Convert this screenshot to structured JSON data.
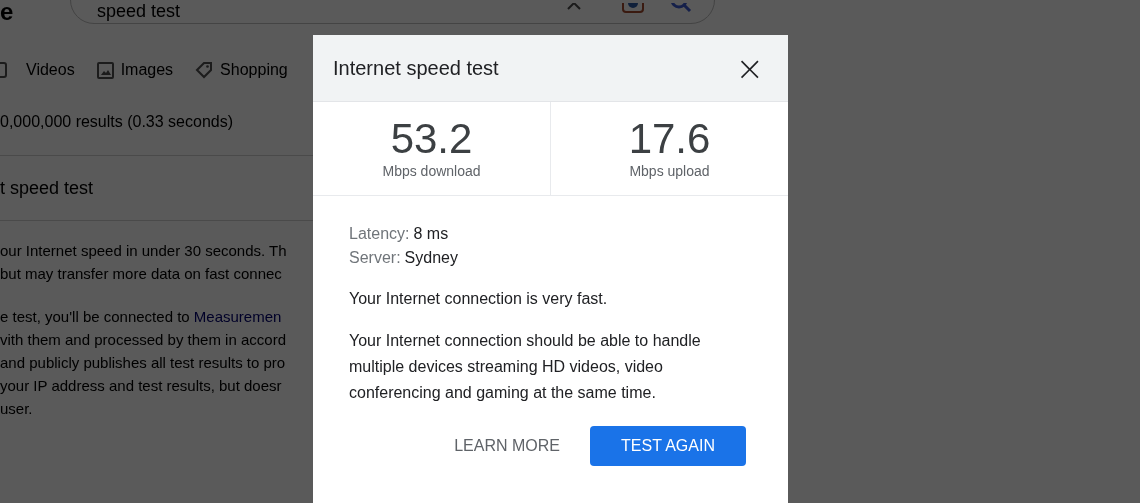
{
  "background_page": {
    "logo_fragment": "e",
    "search": {
      "value": "speed test"
    },
    "tabs": [
      {
        "label": "Videos"
      },
      {
        "label": "Images"
      },
      {
        "label": "Shopping"
      }
    ],
    "result_stats": "0,000,000 results (0.33 seconds)",
    "card_title": "t speed test",
    "paragraphs": [
      [
        {
          "text": "our Internet speed in under 30 seconds. Th"
        },
        {
          "text": " but may transfer more data on fast connec"
        }
      ],
      [
        {
          "text": "e test, you'll be connected to ",
          "link": "Measuremen"
        },
        {
          "text": "vith them and processed by them in accord"
        },
        {
          "text": "and publicly publishes all test results to pro"
        },
        {
          "text": " your IP address and test results, but doesr"
        },
        {
          "text": "user."
        }
      ]
    ]
  },
  "dialog": {
    "title": "Internet speed test",
    "close": "×",
    "stats": [
      {
        "value": "53.2",
        "unit": "Mbps download"
      },
      {
        "value": "17.6",
        "unit": "Mbps upload"
      }
    ],
    "details": [
      {
        "label": "Latency:",
        "value": "8 ms"
      },
      {
        "label": "Server:",
        "value": "Sydney"
      }
    ],
    "verdict": "Your Internet connection is very fast.",
    "description": "Your Internet connection should be able to handle multiple devices streaming HD videos, video conferencing and gaming at the same time.",
    "buttons": [
      {
        "label": "LEARN MORE",
        "kind": "text"
      },
      {
        "label": "TEST AGAIN",
        "kind": "primary"
      }
    ]
  }
}
